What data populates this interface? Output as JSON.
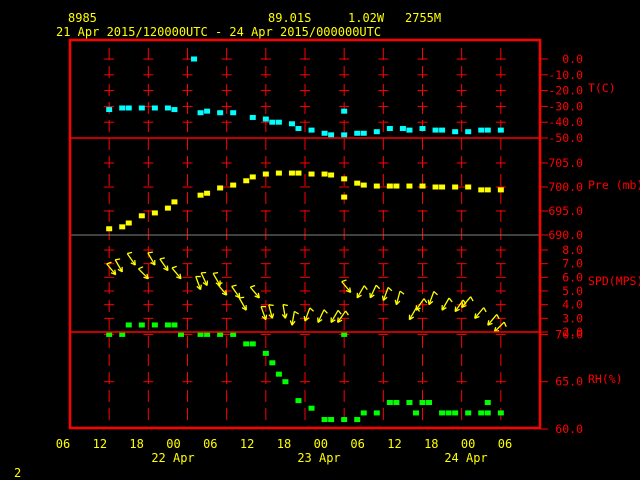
{
  "header": {
    "station": "8985",
    "latitude": "89.01S",
    "longitude": "1.02W",
    "elevation": "2755M",
    "period": "21 Apr 2015/120000UTC - 24 Apr 2015/000000UTC"
  },
  "page_number": "2",
  "colors": {
    "frame": "#ff0000",
    "temperature": "#00ffff",
    "pressure": "#ffff00",
    "wind": "#ffff00",
    "humidity": "#00ff00",
    "text": "#ffff00"
  },
  "chart_data": {
    "type": "scatter",
    "x_range": [
      "2015-04-21T06",
      "2015-04-24T06"
    ],
    "x_tick_labels": [
      "06",
      "12",
      "18",
      "00",
      "06",
      "12",
      "18",
      "00",
      "06",
      "12",
      "18",
      "00",
      "06"
    ],
    "x_date_labels": [
      "22 Apr",
      "23 Apr",
      "24 Apr"
    ],
    "grid": true,
    "panels": [
      {
        "name": "T(C)",
        "ylim": [
          -50,
          0
        ],
        "tick_labels": [
          "0.0",
          "-10.0",
          "-20.0",
          "-30.0",
          "-40.0",
          "-50.0"
        ],
        "tick_values": [
          0,
          -10,
          -20,
          -30,
          -40,
          -50
        ],
        "points": [
          [
            "2015-04-21T12",
            -32
          ],
          [
            "2015-04-21T14",
            -31
          ],
          [
            "2015-04-21T15",
            -31
          ],
          [
            "2015-04-21T17",
            -31
          ],
          [
            "2015-04-21T19",
            -31
          ],
          [
            "2015-04-21T21",
            -31
          ],
          [
            "2015-04-21T22",
            -32
          ],
          [
            "2015-04-22T01",
            0
          ],
          [
            "2015-04-22T02",
            -34
          ],
          [
            "2015-04-22T03",
            -33
          ],
          [
            "2015-04-22T05",
            -34
          ],
          [
            "2015-04-22T07",
            -34
          ],
          [
            "2015-04-22T10",
            -37
          ],
          [
            "2015-04-22T12",
            -38
          ],
          [
            "2015-04-22T13",
            -40
          ],
          [
            "2015-04-22T14",
            -40
          ],
          [
            "2015-04-22T16",
            -41
          ],
          [
            "2015-04-22T17",
            -44
          ],
          [
            "2015-04-22T19",
            -45
          ],
          [
            "2015-04-22T21",
            -47
          ],
          [
            "2015-04-22T22",
            -48
          ],
          [
            "2015-04-23T00",
            -48
          ],
          [
            "2015-04-23T00",
            -33
          ],
          [
            "2015-04-23T02",
            -47
          ],
          [
            "2015-04-23T03",
            -47
          ],
          [
            "2015-04-23T05",
            -46
          ],
          [
            "2015-04-23T07",
            -44
          ],
          [
            "2015-04-23T09",
            -44
          ],
          [
            "2015-04-23T10",
            -45
          ],
          [
            "2015-04-23T12",
            -44
          ],
          [
            "2015-04-23T14",
            -45
          ],
          [
            "2015-04-23T15",
            -45
          ],
          [
            "2015-04-23T17",
            -46
          ],
          [
            "2015-04-23T19",
            -46
          ],
          [
            "2015-04-23T21",
            -45
          ],
          [
            "2015-04-23T22",
            -45
          ],
          [
            "2015-04-24T00",
            -45
          ]
        ]
      },
      {
        "name": "Pre (mb)",
        "ylim": [
          690,
          710
        ],
        "tick_labels": [
          "705.0",
          "700.0",
          "695.0",
          "690.0"
        ],
        "tick_values": [
          705,
          700,
          695,
          690
        ],
        "points": [
          [
            "2015-04-21T12",
            691.3
          ],
          [
            "2015-04-21T14",
            691.7
          ],
          [
            "2015-04-21T15",
            692.5
          ],
          [
            "2015-04-21T17",
            694.0
          ],
          [
            "2015-04-21T19",
            694.6
          ],
          [
            "2015-04-21T21",
            695.6
          ],
          [
            "2015-04-21T22",
            696.9
          ],
          [
            "2015-04-22T02",
            698.3
          ],
          [
            "2015-04-22T03",
            698.7
          ],
          [
            "2015-04-22T05",
            699.8
          ],
          [
            "2015-04-22T07",
            700.4
          ],
          [
            "2015-04-22T09",
            701.3
          ],
          [
            "2015-04-22T10",
            702.1
          ],
          [
            "2015-04-22T12",
            702.7
          ],
          [
            "2015-04-22T14",
            702.9
          ],
          [
            "2015-04-22T16",
            702.9
          ],
          [
            "2015-04-22T17",
            702.9
          ],
          [
            "2015-04-22T19",
            702.7
          ],
          [
            "2015-04-22T21",
            702.7
          ],
          [
            "2015-04-22T22",
            702.5
          ],
          [
            "2015-04-23T00",
            701.7
          ],
          [
            "2015-04-23T00",
            697.9
          ],
          [
            "2015-04-23T02",
            700.8
          ],
          [
            "2015-04-23T03",
            700.4
          ],
          [
            "2015-04-23T05",
            700.2
          ],
          [
            "2015-04-23T07",
            700.2
          ],
          [
            "2015-04-23T08",
            700.2
          ],
          [
            "2015-04-23T10",
            700.2
          ],
          [
            "2015-04-23T12",
            700.2
          ],
          [
            "2015-04-23T14",
            700.0
          ],
          [
            "2015-04-23T15",
            700.0
          ],
          [
            "2015-04-23T17",
            700.0
          ],
          [
            "2015-04-23T19",
            700.0
          ],
          [
            "2015-04-23T21",
            699.4
          ],
          [
            "2015-04-23T22",
            699.4
          ],
          [
            "2015-04-24T00",
            699.4
          ]
        ]
      },
      {
        "name": "SPD(MPS)",
        "ylim": [
          2,
          9
        ],
        "tick_labels": [
          "8.0",
          "7.0",
          "6.0",
          "5.0",
          "4.0",
          "3.0",
          "2.0"
        ],
        "tick_values": [
          8,
          7,
          6,
          5,
          4,
          3,
          2
        ],
        "wind": [
          [
            "2015-04-21T13",
            6.2,
            320
          ],
          [
            "2015-04-21T14",
            6.4,
            330
          ],
          [
            "2015-04-21T16",
            6.9,
            325
          ],
          [
            "2015-04-21T18",
            5.9,
            315
          ],
          [
            "2015-04-21T19",
            6.9,
            330
          ],
          [
            "2015-04-21T21",
            6.5,
            325
          ],
          [
            "2015-04-21T23",
            5.9,
            320
          ],
          [
            "2015-04-22T02",
            5.1,
            340
          ],
          [
            "2015-04-22T03",
            5.4,
            335
          ],
          [
            "2015-04-22T05",
            5.4,
            330
          ],
          [
            "2015-04-22T06",
            4.7,
            320
          ],
          [
            "2015-04-22T08",
            4.5,
            325
          ],
          [
            "2015-04-22T09",
            3.6,
            330
          ],
          [
            "2015-04-22T11",
            4.5,
            320
          ],
          [
            "2015-04-22T12",
            2.9,
            340
          ],
          [
            "2015-04-22T13",
            3.0,
            345
          ],
          [
            "2015-04-22T15",
            3.0,
            350
          ],
          [
            "2015-04-22T16",
            2.5,
            10
          ],
          [
            "2015-04-22T18",
            2.8,
            20
          ],
          [
            "2015-04-22T20",
            2.7,
            25
          ],
          [
            "2015-04-22T22",
            2.7,
            30
          ],
          [
            "2015-04-22T23",
            2.7,
            35
          ],
          [
            "2015-04-23T01",
            4.9,
            320
          ],
          [
            "2015-04-23T02",
            4.5,
            30
          ],
          [
            "2015-04-23T04",
            4.5,
            25
          ],
          [
            "2015-04-23T06",
            4.3,
            20
          ],
          [
            "2015-04-23T08",
            4.0,
            15
          ],
          [
            "2015-04-23T10",
            2.9,
            30
          ],
          [
            "2015-04-23T11",
            3.6,
            35
          ],
          [
            "2015-04-23T13",
            4.0,
            20
          ],
          [
            "2015-04-23T15",
            3.6,
            30
          ],
          [
            "2015-04-23T17",
            3.5,
            35
          ],
          [
            "2015-04-23T18",
            3.8,
            40
          ],
          [
            "2015-04-23T20",
            3.0,
            40
          ],
          [
            "2015-04-23T22",
            2.5,
            40
          ],
          [
            "2015-04-23T23",
            2.0,
            45
          ]
        ]
      },
      {
        "name": "RH(%)",
        "ylim": [
          60,
          75
        ],
        "tick_labels": [
          "70.0",
          "65.0",
          "60.0"
        ],
        "tick_values": [
          70,
          65,
          60
        ],
        "points": [
          [
            "2015-04-21T12",
            70
          ],
          [
            "2015-04-21T14",
            70
          ],
          [
            "2015-04-21T15",
            71
          ],
          [
            "2015-04-21T17",
            71
          ],
          [
            "2015-04-21T19",
            71
          ],
          [
            "2015-04-21T21",
            71
          ],
          [
            "2015-04-21T22",
            71
          ],
          [
            "2015-04-21T23",
            70
          ],
          [
            "2015-04-22T02",
            70
          ],
          [
            "2015-04-22T03",
            70
          ],
          [
            "2015-04-22T05",
            70
          ],
          [
            "2015-04-22T07",
            70
          ],
          [
            "2015-04-22T09",
            69
          ],
          [
            "2015-04-22T10",
            69
          ],
          [
            "2015-04-22T12",
            68
          ],
          [
            "2015-04-22T13",
            67
          ],
          [
            "2015-04-22T14",
            65.8
          ],
          [
            "2015-04-22T15",
            65
          ],
          [
            "2015-04-22T17",
            63
          ],
          [
            "2015-04-22T19",
            62.2
          ],
          [
            "2015-04-22T21",
            61
          ],
          [
            "2015-04-22T22",
            61
          ],
          [
            "2015-04-23T00",
            61
          ],
          [
            "2015-04-23T00",
            70
          ],
          [
            "2015-04-23T02",
            61
          ],
          [
            "2015-04-23T03",
            61.7
          ],
          [
            "2015-04-23T05",
            61.7
          ],
          [
            "2015-04-23T07",
            62.8
          ],
          [
            "2015-04-23T08",
            62.8
          ],
          [
            "2015-04-23T10",
            62.8
          ],
          [
            "2015-04-23T11",
            61.7
          ],
          [
            "2015-04-23T12",
            62.8
          ],
          [
            "2015-04-23T13",
            62.8
          ],
          [
            "2015-04-23T15",
            61.7
          ],
          [
            "2015-04-23T16",
            61.7
          ],
          [
            "2015-04-23T17",
            61.7
          ],
          [
            "2015-04-23T19",
            61.7
          ],
          [
            "2015-04-23T21",
            61.7
          ],
          [
            "2015-04-23T22",
            62.8
          ],
          [
            "2015-04-23T22",
            61.7
          ],
          [
            "2015-04-24T00",
            61.7
          ]
        ]
      }
    ]
  }
}
